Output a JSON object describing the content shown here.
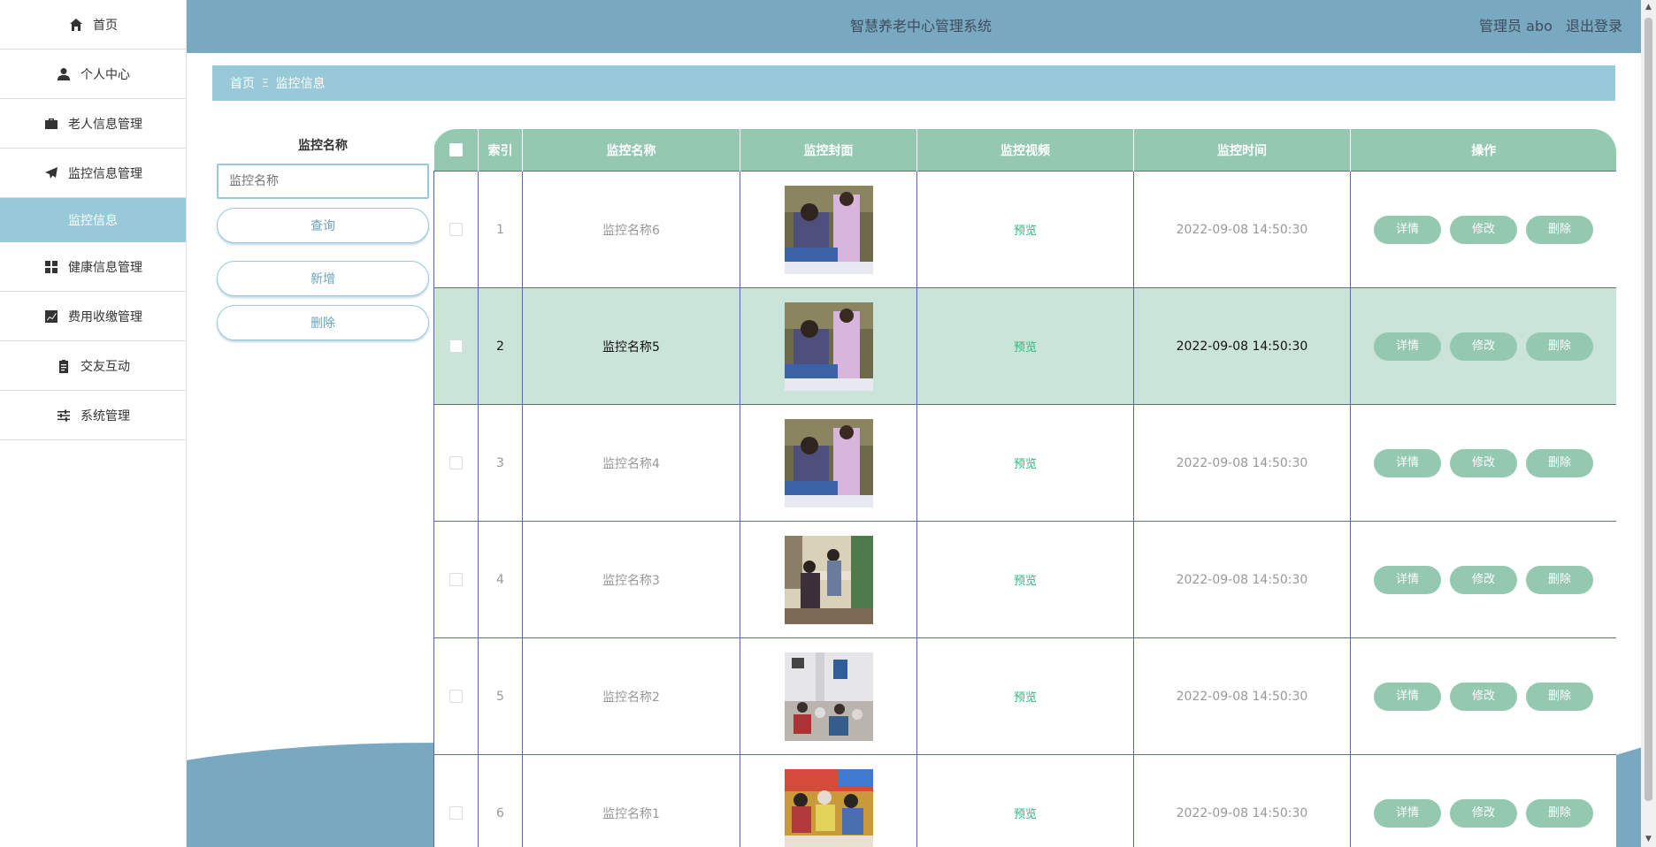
{
  "header": {
    "title": "智慧养老中心管理系统",
    "user_label": "管理员 abo",
    "logout_label": "退出登录"
  },
  "sidebar": {
    "items": [
      {
        "label": "首页",
        "icon": "home-icon"
      },
      {
        "label": "个人中心",
        "icon": "user-icon"
      },
      {
        "label": "老人信息管理",
        "icon": "briefcase-icon"
      },
      {
        "label": "监控信息管理",
        "icon": "paper-plane-icon"
      },
      {
        "label": "监控信息",
        "icon": ""
      },
      {
        "label": "健康信息管理",
        "icon": "grid-icon"
      },
      {
        "label": "费用收缴管理",
        "icon": "chart-line-icon"
      },
      {
        "label": "交友互动",
        "icon": "clipboard-icon"
      },
      {
        "label": "系统管理",
        "icon": "sliders-icon"
      }
    ]
  },
  "breadcrumb": {
    "home": "首页",
    "separator": "Ξ",
    "current": "监控信息"
  },
  "search": {
    "label": "监控名称",
    "placeholder": "监控名称",
    "query_button": "查询",
    "add_button": "新增",
    "delete_button": "删除"
  },
  "table": {
    "columns": [
      "索引",
      "监控名称",
      "监控封面",
      "监控视频",
      "监控时间",
      "操作"
    ],
    "rows": [
      {
        "index": "1",
        "name": "监控名称6",
        "video": "预览",
        "time": "2022-09-08 14:50:30"
      },
      {
        "index": "2",
        "name": "监控名称5",
        "video": "预览",
        "time": "2022-09-08 14:50:30"
      },
      {
        "index": "3",
        "name": "监控名称4",
        "video": "预览",
        "time": "2022-09-08 14:50:30"
      },
      {
        "index": "4",
        "name": "监控名称3",
        "video": "预览",
        "time": "2022-09-08 14:50:30"
      },
      {
        "index": "5",
        "name": "监控名称2",
        "video": "预览",
        "time": "2022-09-08 14:50:30"
      },
      {
        "index": "6",
        "name": "监控名称1",
        "video": "预览",
        "time": "2022-09-08 14:50:30"
      }
    ],
    "actions": {
      "detail": "详情",
      "edit": "修改",
      "delete": "删除"
    }
  },
  "colors": {
    "header": "#79a8c1",
    "breadcrumb": "#98c9d8",
    "table_header": "#94c8b1",
    "highlight_row": "#cbe4d9",
    "preview_link": "#27b97a"
  }
}
